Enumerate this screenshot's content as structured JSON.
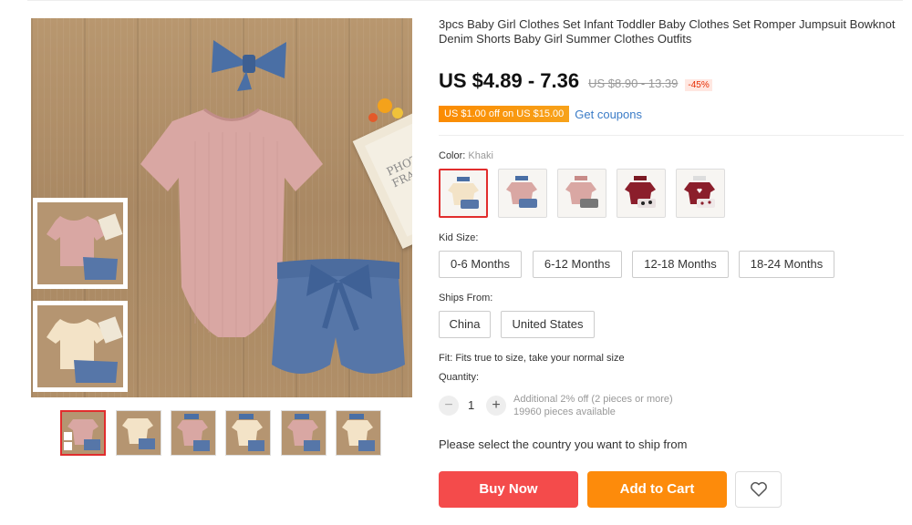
{
  "product": {
    "title": "3pcs Baby Girl Clothes Set Infant Toddler Baby Clothes Set Romper Jumpsuit Bowknot Denim Shorts Baby Girl Summer Clothes Outfits"
  },
  "pricing": {
    "price": "US $4.89 - 7.36",
    "original_price": "US $8.90 - 13.39",
    "discount": "-45%"
  },
  "coupon": {
    "badge": "US $1.00 off on US $15.00",
    "link": "Get coupons"
  },
  "gallery": {
    "frame_text_1": "PHOTO",
    "frame_text_2": "FRAME",
    "side_thumbs": [
      "pink romper set",
      "khaki romper set"
    ],
    "thumbnails": [
      "pink",
      "khaki",
      "pink",
      "khaki",
      "pink",
      "khaki"
    ]
  },
  "color": {
    "label": "Color:",
    "selected": "Khaki",
    "swatches": [
      "khaki",
      "pink",
      "pink-grey",
      "wine-red",
      "wine-red-print"
    ]
  },
  "size": {
    "label": "Kid Size:",
    "options": [
      "0-6 Months",
      "6-12 Months",
      "12-18 Months",
      "18-24 Months"
    ]
  },
  "ships_from": {
    "label": "Ships From:",
    "options": [
      "China",
      "United States"
    ]
  },
  "fit": "Fit: Fits true to size, take your normal size",
  "quantity": {
    "label": "Quantity:",
    "value": "1",
    "minus": "−",
    "plus": "+",
    "info_line1": "Additional 2% off (2 pieces or more)",
    "info_line2": "19960 pieces available"
  },
  "ship_note": "Please select the country you want to ship from",
  "actions": {
    "buy_now": "Buy Now",
    "add_to_cart": "Add to Cart",
    "wishlist_icon": "heart-icon"
  },
  "colors": {
    "primary_red": "#f44b4b",
    "cart_orange": "#fd8b0b",
    "selected_border": "#e12d2d",
    "link_blue": "#3b7cc7"
  }
}
